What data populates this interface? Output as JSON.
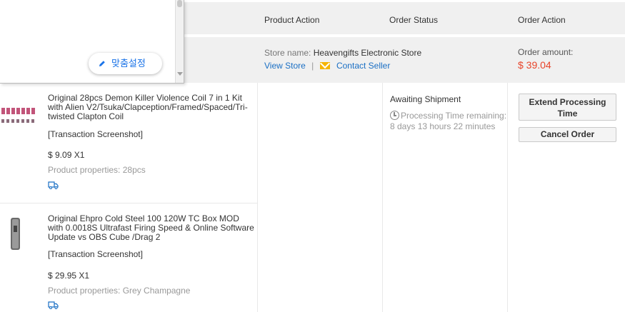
{
  "header": {
    "product_action": "Product Action",
    "order_status": "Order Status",
    "order_action": "Order Action"
  },
  "store": {
    "name_label": "Store name:",
    "name": "Heavengifts Electronic Store",
    "view_store": "View Store",
    "separator": "|",
    "contact_seller": "Contact Seller",
    "mail_icon": "mail-icon"
  },
  "order": {
    "amount_label": "Order amount:",
    "amount": "$ 39.04",
    "amount_color": "#e8452b",
    "status": "Awaiting Shipment",
    "processing_time": "Processing Time remaining: 8 days 13 hours 22 minutes",
    "clock_icon": "clock-icon"
  },
  "actions": {
    "extend_line1": "Extend Processing",
    "extend_line2": "Time",
    "cancel": "Cancel Order"
  },
  "products": [
    {
      "title": "Original 28pcs Demon Killer Violence Coil 7 in 1 Kit with Alien V2/Tsuka/Clapception/Framed/Spaced/Tri-twisted Clapton Coil",
      "screenshot_link": "[Transaction Screenshot]",
      "price": "$ 9.09 X1",
      "properties": "Product properties: 28pcs",
      "shipping_icon": "truck-icon"
    },
    {
      "title": "Original Ehpro Cold Steel 100 120W TC Box MOD with 0.0018S Ultrafast Firing Speed & Online Software Update vs OBS Cube /Drag 2",
      "screenshot_link": "[Transaction Screenshot]",
      "price": "$ 29.95 X1",
      "properties": "Product properties: Grey Champagne",
      "shipping_icon": "truck-icon"
    }
  ],
  "popup": {
    "button_label": "맞춤설정",
    "icon": "pencil-icon"
  },
  "colors": {
    "link": "#1a6fc4",
    "header_bg": "#f0f0f0",
    "accent_blue": "#1a73e8"
  }
}
